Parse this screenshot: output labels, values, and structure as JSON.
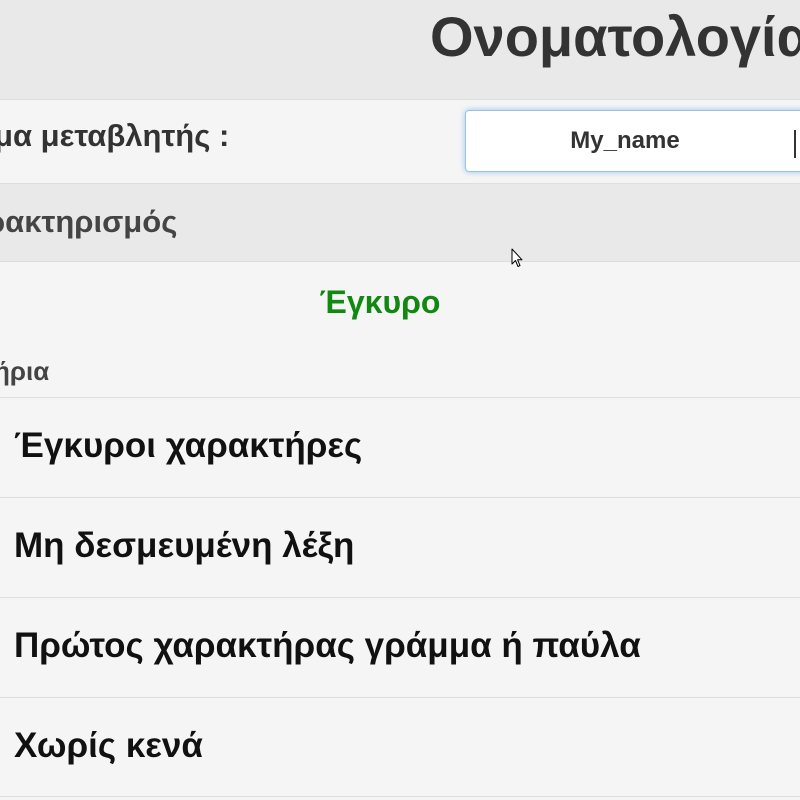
{
  "header": {
    "title": "Ονοματολογία"
  },
  "variable_field": {
    "label": "μα μεταβλητής :",
    "value": "My_name"
  },
  "characterization": {
    "title": "ρακτηρισμός",
    "result": "Έγκυρο",
    "result_color": "#118811"
  },
  "criteria": {
    "label": "ήρια",
    "items": [
      {
        "label": "Έγκυροι χαρακτήρες"
      },
      {
        "label": "Μη δεσμευμένη λέξη"
      },
      {
        "label": "Πρώτος χαρακτήρας γράμμα ή παύλα"
      },
      {
        "label": "Χωρίς κενά"
      }
    ]
  }
}
